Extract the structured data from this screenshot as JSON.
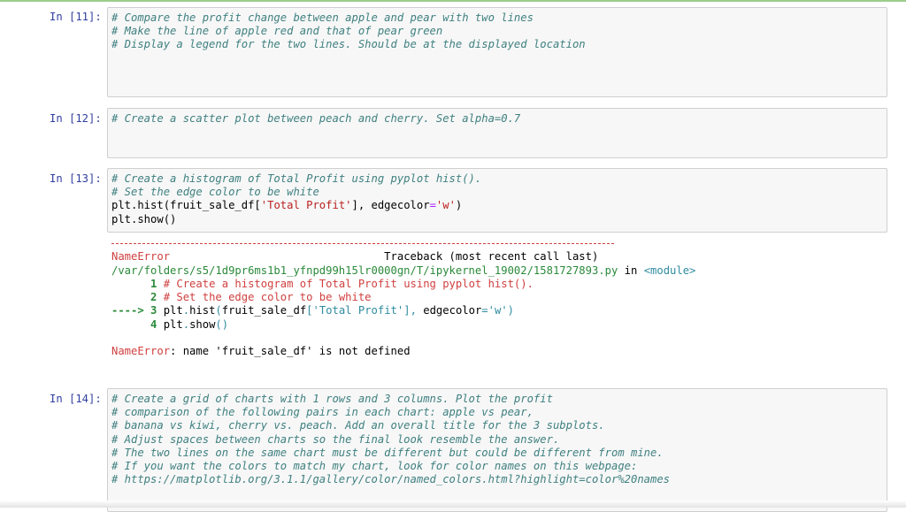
{
  "cells": [
    {
      "prompt": "In [11]:",
      "lines": [
        [
          {
            "t": "# Compare the profit change between apple and pear with two lines",
            "c": "cm"
          }
        ],
        [
          {
            "t": "# Make the line of apple red and that of pear green",
            "c": "cm"
          }
        ],
        [
          {
            "t": "# Display a legend for the two lines. Should be at the displayed location",
            "c": "cm"
          }
        ]
      ]
    },
    {
      "prompt": "In [12]:",
      "lines": [
        [
          {
            "t": "# Create a scatter plot between peach and cherry. Set alpha=0.7",
            "c": "cm"
          }
        ]
      ]
    },
    {
      "prompt": "In [13]:",
      "lines": [
        [
          {
            "t": "# Create a histogram of Total Profit using pyplot hist().",
            "c": "cm"
          }
        ],
        [
          {
            "t": "# Set the edge color to be white",
            "c": "cm"
          }
        ],
        [
          {
            "t": "plt.hist(fruit_sale_df[",
            "c": ""
          },
          {
            "t": "'Total Profit'",
            "c": "str"
          },
          {
            "t": "], edgecolor",
            "c": ""
          },
          {
            "t": "=",
            "c": "op"
          },
          {
            "t": "'w'",
            "c": "str"
          },
          {
            "t": ")",
            "c": ""
          }
        ],
        [
          {
            "t": "plt.show()",
            "c": ""
          }
        ]
      ],
      "output": [
        {
          "dash": true
        },
        [
          {
            "t": "NameError",
            "c": "err"
          },
          {
            "t": "                                 Traceback (most recent call last)",
            "c": ""
          }
        ],
        [
          {
            "t": "/var/folders/s5/1d9pr6ms1b1_yfnpd99h15lr0000gn/T/ipykernel_19002/1581727893.py",
            "c": "green"
          },
          {
            "t": " in ",
            "c": ""
          },
          {
            "t": "<module>",
            "c": "cyan"
          }
        ],
        [
          {
            "t": "      1 ",
            "c": "bold green"
          },
          {
            "t": "# Create a histogram of Total Profit using pyplot hist().",
            "c": "err"
          }
        ],
        [
          {
            "t": "      2 ",
            "c": "bold green"
          },
          {
            "t": "# Set the edge color to be white",
            "c": "err"
          }
        ],
        [
          {
            "t": "----> 3 ",
            "c": "bold green"
          },
          {
            "t": "plt",
            "c": ""
          },
          {
            "t": ".",
            "c": "cyan"
          },
          {
            "t": "hist",
            "c": ""
          },
          {
            "t": "(",
            "c": "cyan"
          },
          {
            "t": "fruit_sale_df",
            "c": ""
          },
          {
            "t": "[",
            "c": "cyan"
          },
          {
            "t": "'Total Profit'",
            "c": "cyan"
          },
          {
            "t": "]",
            "c": "cyan"
          },
          {
            "t": ",",
            "c": "cyan"
          },
          {
            "t": " edgecolor",
            "c": ""
          },
          {
            "t": "=",
            "c": "cyan"
          },
          {
            "t": "'w'",
            "c": "cyan"
          },
          {
            "t": ")",
            "c": "cyan"
          }
        ],
        [
          {
            "t": "      4 ",
            "c": "bold green"
          },
          {
            "t": "plt",
            "c": ""
          },
          {
            "t": ".",
            "c": "cyan"
          },
          {
            "t": "show",
            "c": ""
          },
          {
            "t": "()",
            "c": "cyan"
          }
        ],
        [
          {
            "t": "",
            "c": ""
          }
        ],
        [
          {
            "t": "NameError",
            "c": "err"
          },
          {
            "t": ": name 'fruit_sale_df' is not defined",
            "c": ""
          }
        ]
      ]
    },
    {
      "prompt": "In [14]:",
      "lines": [
        [
          {
            "t": "# Create a grid of charts with 1 rows and 3 columns. Plot the profit",
            "c": "cm"
          }
        ],
        [
          {
            "t": "# comparison of the following pairs in each chart: apple vs pear,",
            "c": "cm"
          }
        ],
        [
          {
            "t": "# banana vs kiwi, cherry vs. peach. Add an overall title for the 3 subplots.",
            "c": "cm"
          }
        ],
        [
          {
            "t": "# Adjust spaces between charts so the final look resemble the answer.",
            "c": "cm"
          }
        ],
        [
          {
            "t": "# The two lines on the same chart must be different but could be different from mine.",
            "c": "cm"
          }
        ],
        [
          {
            "t": "# If you want the colors to match my chart, look for color names on this webpage:",
            "c": "cm"
          }
        ],
        [
          {
            "t": "# https://matplotlib.org/3.1.1/gallery/color/named_colors.html?highlight=color%20names",
            "c": "cm"
          }
        ]
      ]
    }
  ]
}
